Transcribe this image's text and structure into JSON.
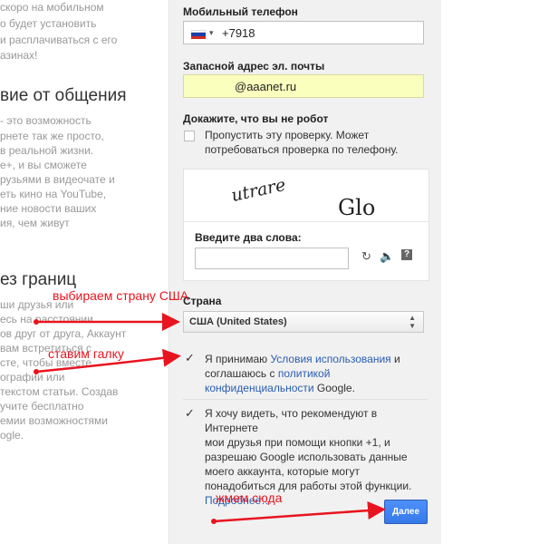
{
  "left_column": {
    "intro_lines": [
      "скоро на мобильном",
      "о будет установить",
      "и расплачиваться с его",
      "азинах!"
    ],
    "section1_heading": "вие от общения",
    "section1_lines": [
      "- это возможность",
      "рнете так же просто,",
      "в реальной жизни.",
      "e+, и вы сможете",
      "рузьями в видеочате и",
      "еть кино на YouTube,",
      "ние новости ваших",
      "ия, чем живут"
    ],
    "section2_heading": "ез границ",
    "section2_lines": [
      "ши друзья или",
      "есь на расстоянии",
      "ов друг от друга, Аккаунт",
      "вам встретиться с",
      "сте, чтобы вместе",
      "ографии или",
      "текстом статьи. Создав",
      "учите бесплатно",
      "емии возможностями",
      "ogle."
    ]
  },
  "form": {
    "phone_label": "Мобильный телефон",
    "phone_value": "+7918",
    "email_label": "Запасной адрес эл. почты",
    "email_value": "@aaanet.ru",
    "robot_label": "Докажите, что вы не робот",
    "skip_line1": "Пропустить эту проверку. Может",
    "skip_line2": "потребоваться проверка по телефону.",
    "captcha_word1": "utrare",
    "captcha_word2": "Glo",
    "captcha_prompt": "Введите два слова:",
    "captcha_icon_refresh": "refresh-icon",
    "captcha_icon_audio": "audio-icon",
    "captcha_icon_help": "help-icon",
    "country_label": "Страна",
    "country_value": "США (United States)",
    "terms_prefix": "Я принимаю ",
    "terms_link": "Условия использования",
    "terms_mid": " и",
    "terms_line2_prefix": "соглашаюсь с ",
    "terms_link2": "политикой",
    "terms_link3": "конфиденциальности",
    "terms_suffix": " Google.",
    "rec_lines": [
      "Я хочу видеть, что рекомендуют в Интернете",
      "мои друзья при помощи кнопки +1, и",
      "разрешаю Google использовать данные",
      "моего аккаунта, которые могут",
      "понадобиться для работы этой функции."
    ],
    "rec_more": "Подробнее…",
    "next_button": "Далее"
  },
  "annotations": {
    "country": "выбираем страну США",
    "checkbox": "ставим галку",
    "button": "жмем сюда"
  },
  "colors": {
    "annotation": "#e8141f",
    "link": "#2a5db0",
    "button": "#4d90fe",
    "autofill": "#faffbd"
  }
}
